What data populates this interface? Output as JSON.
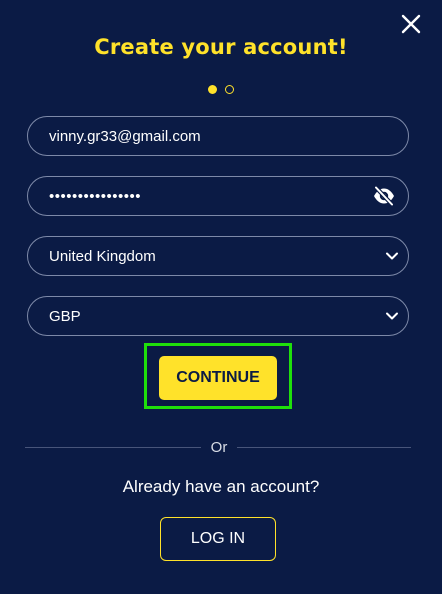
{
  "modal": {
    "title": "Create your account!",
    "step_indicator": {
      "current": 1,
      "total": 2
    }
  },
  "form": {
    "email": {
      "value": "vinny.gr33@gmail.com"
    },
    "password": {
      "masked_value": "••••••••••••••••"
    },
    "country": {
      "selected": "United Kingdom"
    },
    "currency": {
      "selected": "GBP"
    },
    "continue_label": "CONTINUE"
  },
  "footer": {
    "or_label": "Or",
    "already_text": "Already have an account?",
    "login_label": "LOG IN"
  },
  "icons": {
    "close": "close-icon",
    "password_toggle": "eye-slash-icon",
    "dropdown": "chevron-down-icon"
  },
  "colors": {
    "background": "#0b1b45",
    "accent": "#ffe22a",
    "field_border": "#7d89a8",
    "highlight": "#1fe00b"
  }
}
